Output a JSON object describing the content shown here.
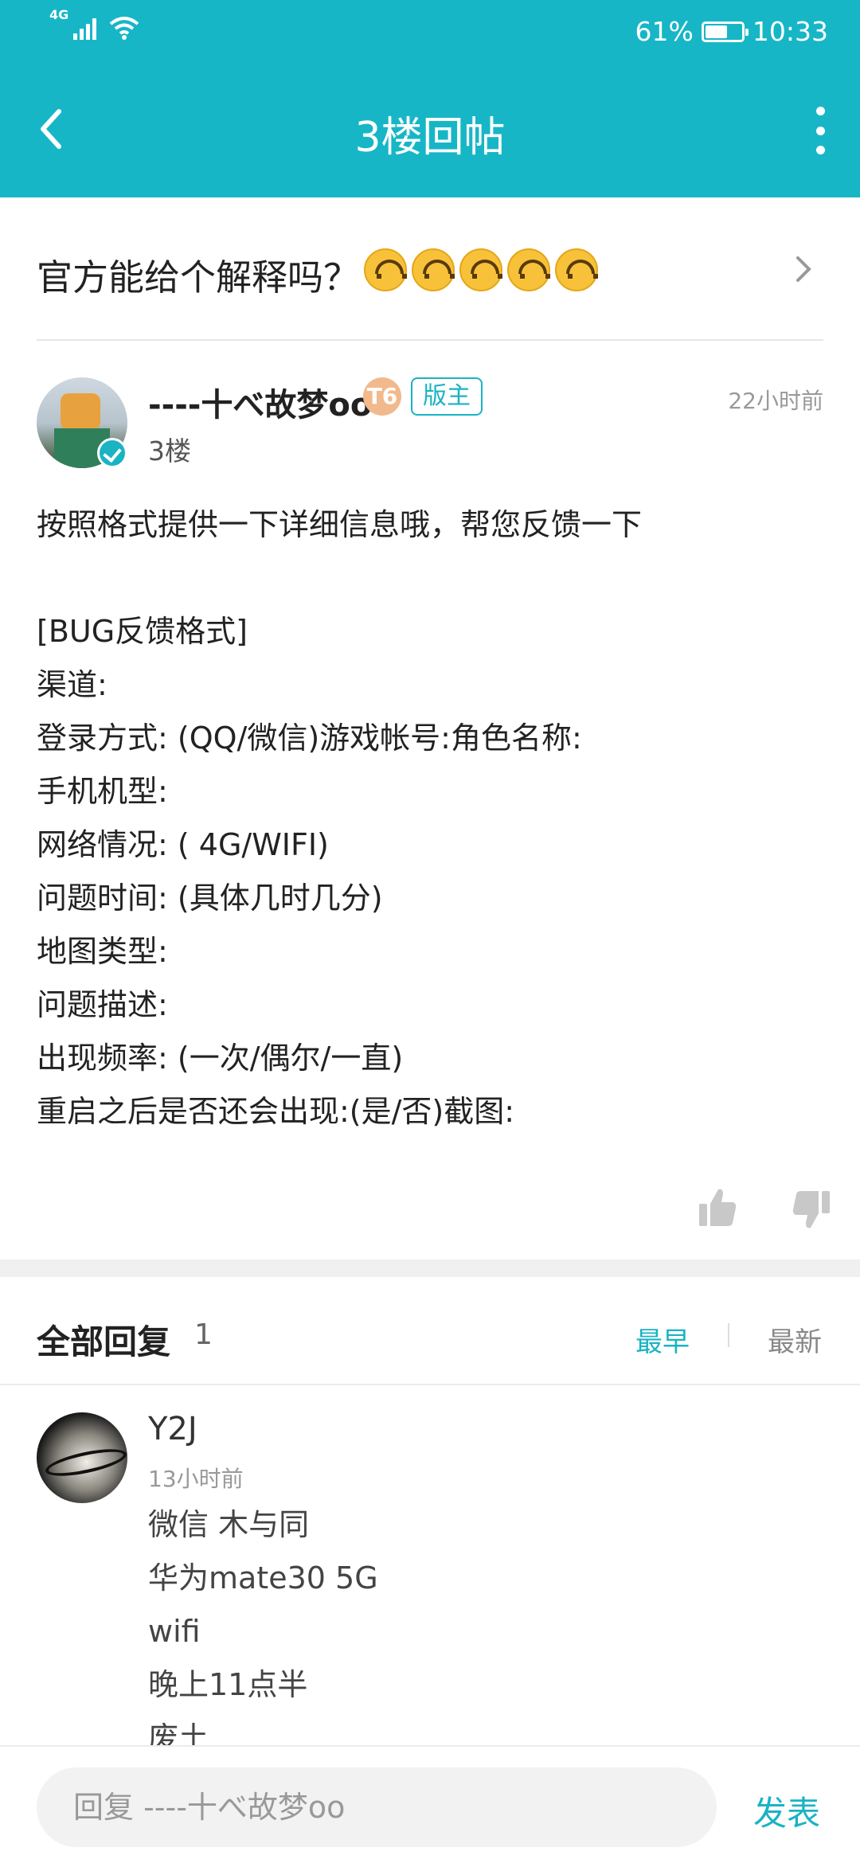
{
  "status_bar": {
    "network": "4G",
    "battery": "61%",
    "battery_level": 0.61,
    "time": "10:33"
  },
  "header": {
    "title": "3楼回帖"
  },
  "topic": {
    "text": "官方能给个解释吗？",
    "emoji_count": 5
  },
  "post": {
    "author": "----十べ故梦oo",
    "level_badge": "T6",
    "role_badge": "版主",
    "floor": "3楼",
    "time": "22小时前",
    "lines": [
      "按照格式提供一下详细信息哦，帮您反馈一下",
      "",
      "[BUG反馈格式]",
      "渠道:",
      "登录方式: (QQ/微信)游戏帐号:角色名称:",
      "手机机型:",
      "网络情况: ( 4G/WIFI)",
      "问题时间: (具体几时几分)",
      "地图类型:",
      "问题描述:",
      "出现频率: (一次/偶尔/一直)",
      "重启之后是否还会出现:(是/否)截图:"
    ]
  },
  "replies": {
    "label": "全部回复",
    "count": "1",
    "sort_earliest": "最早",
    "sort_newest": "最新",
    "items": [
      {
        "name": "Y2J",
        "time": "13小时前",
        "lines": [
          "微信 木与同",
          "华为mate30 5G",
          "wifi",
          "晚上11点半",
          "废土"
        ]
      }
    ]
  },
  "compose": {
    "placeholder": "回复 ----十べ故梦oo",
    "send_label": "发表"
  },
  "colors": {
    "accent": "#17b6c7"
  }
}
